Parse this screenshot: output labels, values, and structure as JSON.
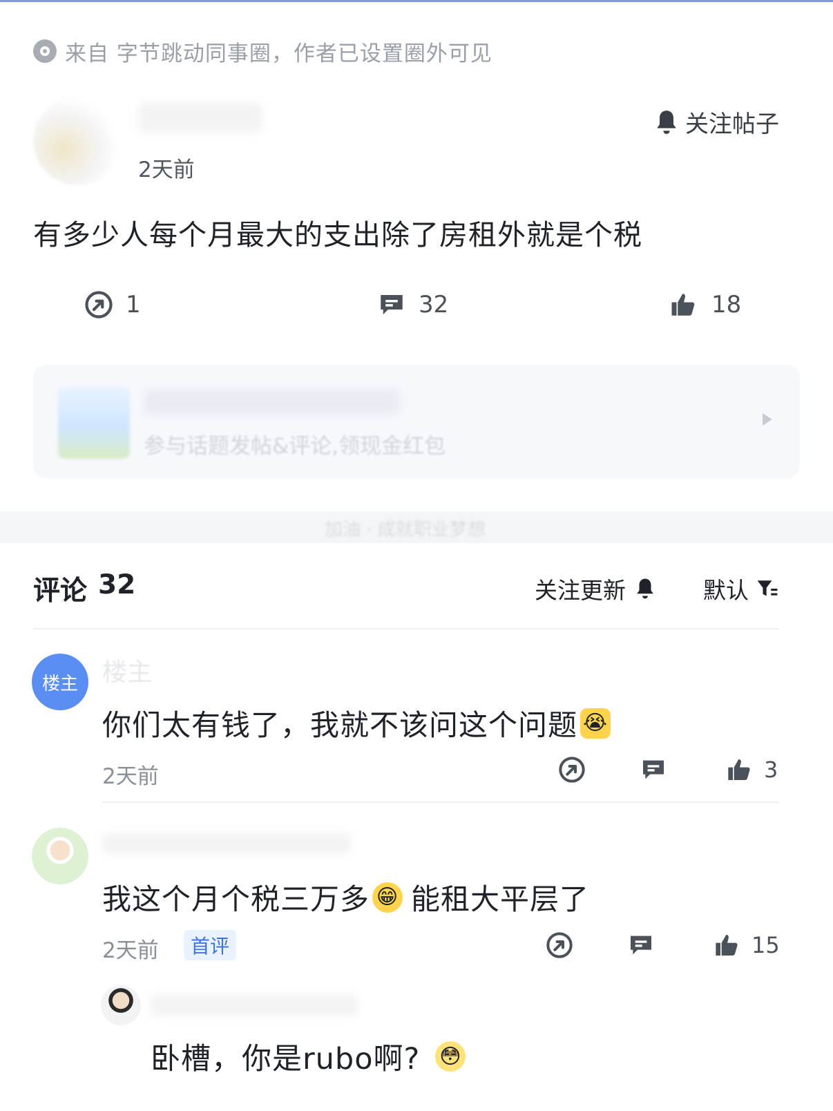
{
  "source": {
    "text": "来自 字节跳动同事圈，作者已设置圈外可见"
  },
  "post": {
    "time": "2天前",
    "follow_label": "关注帖子",
    "text": "有多少人每个月最大的支出除了房租外就是个税",
    "repost_count": "1",
    "comment_count": "32",
    "like_count": "18"
  },
  "topic_card": {
    "subtitle": "参与话题发帖&评论,领现金红包"
  },
  "divider_text": "加油 · 成就职业梦想",
  "comments_header": {
    "label": "评论",
    "count": "32",
    "follow_update": "关注更新",
    "sort": "默认"
  },
  "comments": [
    {
      "name": "楼主",
      "avatar_text": "楼主",
      "text": "你们太有钱了，我就不该问这个问题",
      "time": "2天前",
      "likes": "3"
    },
    {
      "text": "我这个月个税三万多",
      "text_after": "能租大平层了",
      "time": "2天前",
      "tag": "首评",
      "likes": "15"
    }
  ],
  "reply": {
    "text": "卧槽，你是rubo啊?"
  },
  "colors": {
    "accent_blue": "#3c73e6",
    "host_avatar": "#5b8ef2",
    "top_line": "#7f9bdc"
  }
}
